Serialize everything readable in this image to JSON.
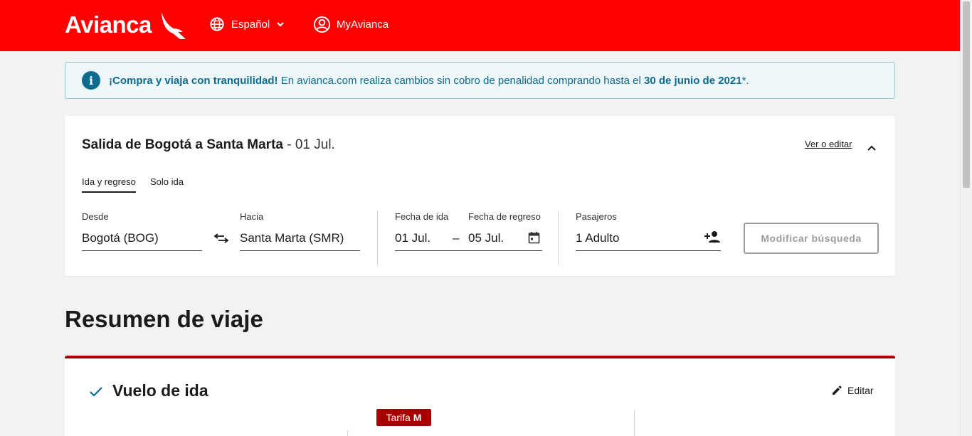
{
  "header": {
    "logo": "Avianca",
    "language": "Español",
    "account": "MyAvianca"
  },
  "banner": {
    "bold_lead": "¡Compra y viaja con tranquilidad!",
    "text": " En avianca.com realiza cambios sin cobro de penalidad comprando hasta el ",
    "bold_date": "30 de junio de 2021",
    "suffix": "*."
  },
  "search": {
    "route_title": "Salida de Bogotá a Santa Marta",
    "route_date": " - 01 Jul.",
    "view_edit": "Ver o editar",
    "tabs": [
      "Ida y regreso",
      "Solo ida"
    ],
    "from_label": "Desde",
    "from_value": "Bogotá (BOG)",
    "to_label": "Hacia",
    "to_value": "Santa Marta (SMR)",
    "depart_label": "Fecha de ida",
    "depart_value": "01 Jul.",
    "return_label": "Fecha de regreso",
    "return_value": "05 Jul.",
    "pax_label": "Pasajeros",
    "pax_value": "1 Adulto",
    "modify_button": "Modificar búsqueda"
  },
  "summary": {
    "title": "Resumen de viaje",
    "flight_title": "Vuelo de ida",
    "edit": "Editar",
    "fare_prefix": "Tarifa",
    "fare_code": "M"
  },
  "colors": {
    "brand_red": "#ff0000",
    "dark_red": "#a80000",
    "info_blue": "#0c6b8f"
  }
}
